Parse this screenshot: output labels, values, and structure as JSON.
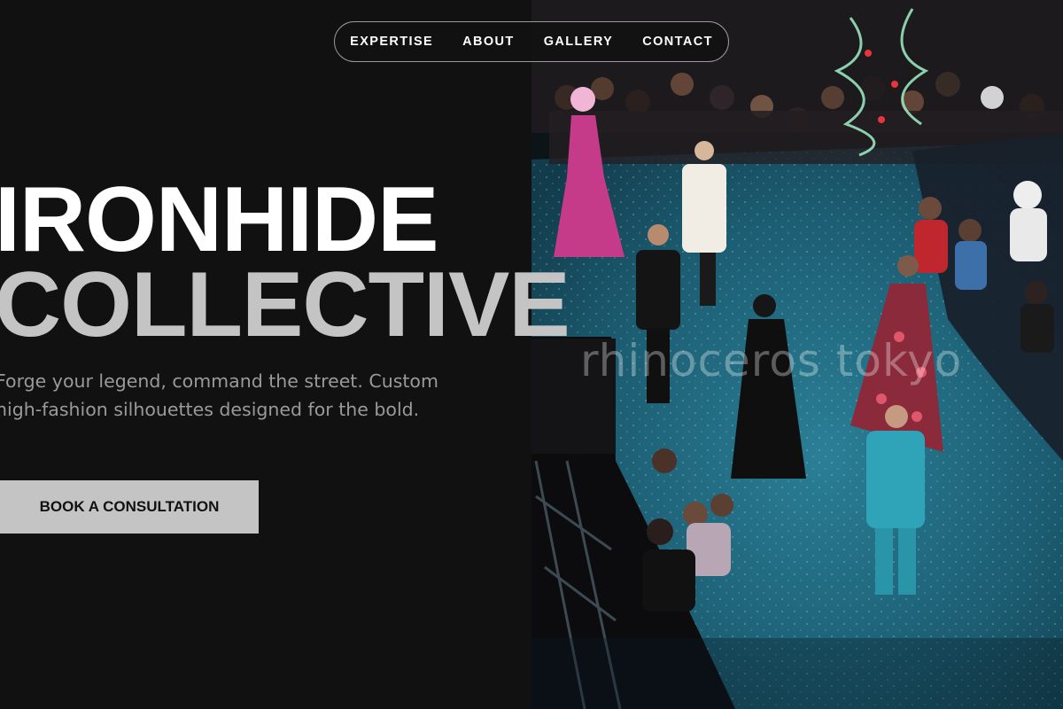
{
  "nav": {
    "items": [
      {
        "label": "EXPERTISE"
      },
      {
        "label": "ABOUT"
      },
      {
        "label": "GALLERY"
      },
      {
        "label": "CONTACT"
      }
    ]
  },
  "hero": {
    "title_line1": "IRONHIDE",
    "title_line2": "COLLECTIVE",
    "subtitle": "Forge your legend, command the street. Custom high-fashion silhouettes designed for the bold.",
    "cta_label": "BOOK A CONSULTATION"
  },
  "photo": {
    "watermark": "rhinoceros tokyo",
    "description_icon": "fashion-runway-photo"
  },
  "colors": {
    "background": "#111111",
    "title_primary": "#ffffff",
    "title_secondary": "#c4c4c4",
    "subtitle": "#9a9a9a",
    "cta_background": "#c4c4c4",
    "cta_text": "#111111",
    "runway": "#1d5a6e"
  }
}
